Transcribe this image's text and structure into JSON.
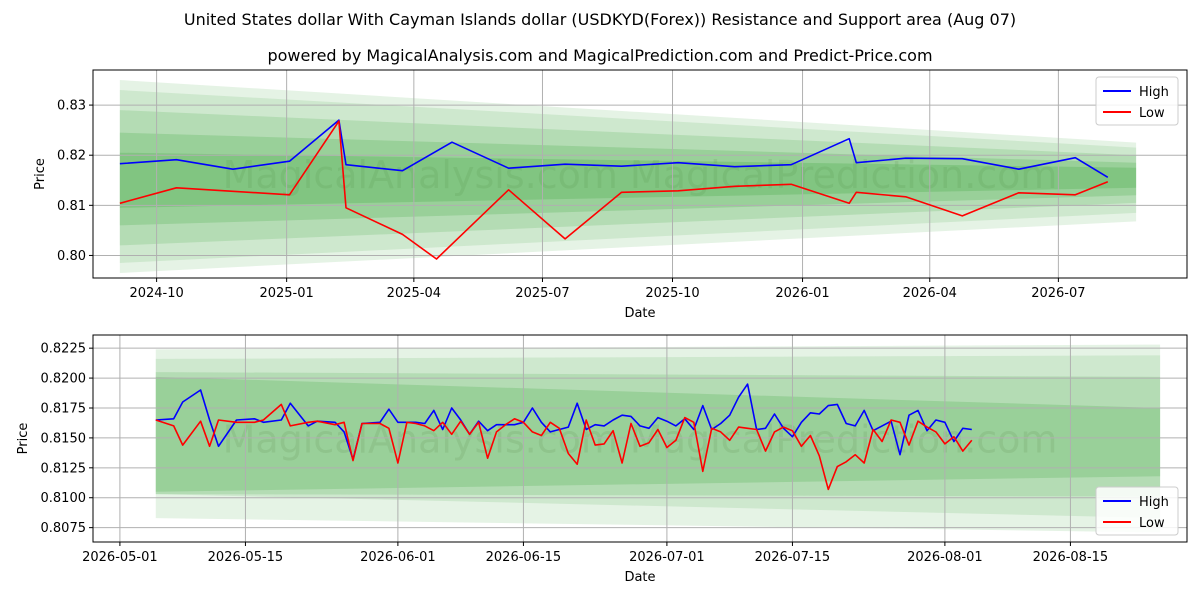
{
  "title": "United States dollar With Cayman Islands dollar (USDKYD(Forex)) Resistance and Support area (Aug 07)",
  "subtitle": "powered by MagicalAnalysis.com and MagicalPrediction.com and Predict-Price.com",
  "watermark": "MagicalAnalysis.com   MagicalPrediction.com",
  "colors": {
    "high": "#0000ff",
    "low": "#ff0000",
    "band": "#2ca02c"
  },
  "chart_data": [
    {
      "type": "line",
      "xlabel": "Date",
      "ylabel": "Price",
      "xticks": [
        "2024-10",
        "2025-01",
        "2025-04",
        "2025-07",
        "2025-10",
        "2026-01",
        "2026-04",
        "2026-07"
      ],
      "yticks": [
        "0.80",
        "0.81",
        "0.82",
        "0.83"
      ],
      "xlim": [
        "2024-08-17",
        "2026-09-30"
      ],
      "ylim": [
        0.7955,
        0.837
      ],
      "grid": true,
      "legend": "top-right",
      "series": [
        {
          "name": "High",
          "x": [
            "2024-09-05",
            "2024-10-15",
            "2024-11-24",
            "2025-01-03",
            "2025-02-07",
            "2025-02-12",
            "2025-03-24",
            "2025-04-28",
            "2025-06-07",
            "2025-07-17",
            "2025-08-26",
            "2025-10-05",
            "2025-11-14",
            "2025-12-24",
            "2026-02-03",
            "2026-02-08",
            "2026-03-15",
            "2026-04-24",
            "2026-06-03",
            "2026-07-13",
            "2026-08-05"
          ],
          "y": [
            0.8183,
            0.8191,
            0.8172,
            0.8188,
            0.827,
            0.8181,
            0.8169,
            0.8226,
            0.8174,
            0.8182,
            0.8178,
            0.8185,
            0.8177,
            0.8181,
            0.8233,
            0.8185,
            0.8194,
            0.8193,
            0.8172,
            0.8195,
            0.8156
          ]
        },
        {
          "name": "Low",
          "x": [
            "2024-09-05",
            "2024-10-15",
            "2024-11-24",
            "2025-01-03",
            "2025-02-07",
            "2025-02-12",
            "2025-03-24",
            "2025-04-17",
            "2025-06-07",
            "2025-07-17",
            "2025-08-26",
            "2025-10-05",
            "2025-11-14",
            "2025-12-24",
            "2026-02-03",
            "2026-02-08",
            "2026-03-15",
            "2026-04-24",
            "2026-06-03",
            "2026-07-13",
            "2026-08-05"
          ],
          "y": [
            0.8104,
            0.8135,
            0.8128,
            0.8121,
            0.8268,
            0.8095,
            0.8042,
            0.7993,
            0.8131,
            0.8033,
            0.8126,
            0.8129,
            0.8138,
            0.8142,
            0.8104,
            0.8126,
            0.8117,
            0.8079,
            0.8125,
            0.8121,
            0.8147
          ]
        }
      ],
      "bands": [
        {
          "x": [
            "2024-09-05",
            "2026-08-25"
          ],
          "upper": [
            0.835,
            0.8225
          ],
          "lower": [
            0.7965,
            0.8068
          ]
        },
        {
          "x": [
            "2024-09-05",
            "2026-08-25"
          ],
          "upper": [
            0.833,
            0.8215
          ],
          "lower": [
            0.7985,
            0.8085
          ]
        },
        {
          "x": [
            "2024-09-05",
            "2026-08-25"
          ],
          "upper": [
            0.829,
            0.82
          ],
          "lower": [
            0.802,
            0.8105
          ]
        },
        {
          "x": [
            "2024-09-05",
            "2026-08-25"
          ],
          "upper": [
            0.8245,
            0.8185
          ],
          "lower": [
            0.806,
            0.812
          ]
        },
        {
          "x": [
            "2024-09-05",
            "2026-08-25"
          ],
          "upper": [
            0.8205,
            0.8175
          ],
          "lower": [
            0.8095,
            0.8135
          ]
        }
      ]
    },
    {
      "type": "line",
      "xlabel": "Date",
      "ylabel": "Price",
      "xticks": [
        "2026-05-01",
        "2026-05-15",
        "2026-06-01",
        "2026-06-15",
        "2026-07-01",
        "2026-07-15",
        "2026-08-01",
        "2026-08-15"
      ],
      "yticks": [
        "0.8075",
        "0.8100",
        "0.8125",
        "0.8150",
        "0.8175",
        "0.8200",
        "0.8225"
      ],
      "xlim": [
        "2026-04-28",
        "2026-08-28"
      ],
      "ylim": [
        0.8063,
        0.8236
      ],
      "grid": true,
      "legend": "bottom-right",
      "series": [
        {
          "name": "High",
          "x": [
            "2026-05-05",
            "2026-05-07",
            "2026-05-08",
            "2026-05-10",
            "2026-05-11",
            "2026-05-12",
            "2026-05-14",
            "2026-05-16",
            "2026-05-17",
            "2026-05-19",
            "2026-05-20",
            "2026-05-22",
            "2026-05-23",
            "2026-05-25",
            "2026-05-26",
            "2026-05-27",
            "2026-05-28",
            "2026-05-30",
            "2026-05-31",
            "2026-06-01",
            "2026-06-02",
            "2026-06-03",
            "2026-06-04",
            "2026-06-05",
            "2026-06-06",
            "2026-06-07",
            "2026-06-08",
            "2026-06-09",
            "2026-06-10",
            "2026-06-11",
            "2026-06-12",
            "2026-06-13",
            "2026-06-14",
            "2026-06-15",
            "2026-06-16",
            "2026-06-17",
            "2026-06-18",
            "2026-06-19",
            "2026-06-20",
            "2026-06-21",
            "2026-06-22",
            "2026-06-23",
            "2026-06-24",
            "2026-06-25",
            "2026-06-26",
            "2026-06-27",
            "2026-06-28",
            "2026-06-29",
            "2026-06-30",
            "2026-07-01",
            "2026-07-02",
            "2026-07-03",
            "2026-07-04",
            "2026-07-05",
            "2026-07-06",
            "2026-07-07",
            "2026-07-08",
            "2026-07-09",
            "2026-07-10",
            "2026-07-11",
            "2026-07-12",
            "2026-07-13",
            "2026-07-14",
            "2026-07-15",
            "2026-07-16",
            "2026-07-17",
            "2026-07-18",
            "2026-07-19",
            "2026-07-20",
            "2026-07-21",
            "2026-07-22",
            "2026-07-23",
            "2026-07-24",
            "2026-07-25",
            "2026-07-26",
            "2026-07-27",
            "2026-07-28",
            "2026-07-29",
            "2026-07-30",
            "2026-07-31",
            "2026-08-01",
            "2026-08-02",
            "2026-08-03",
            "2026-08-04"
          ],
          "y": [
            0.8165,
            0.8166,
            0.818,
            0.819,
            0.8165,
            0.8143,
            0.8165,
            0.8166,
            0.8163,
            0.8165,
            0.8179,
            0.816,
            0.8164,
            0.8163,
            0.8155,
            0.8132,
            0.8162,
            0.8163,
            0.8174,
            0.8163,
            0.8163,
            0.8163,
            0.8162,
            0.8173,
            0.8157,
            0.8175,
            0.8165,
            0.8153,
            0.8164,
            0.8156,
            0.8161,
            0.8161,
            0.8161,
            0.8163,
            0.8175,
            0.8163,
            0.8155,
            0.8157,
            0.8159,
            0.8179,
            0.8157,
            0.8161,
            0.816,
            0.8165,
            0.8169,
            0.8168,
            0.816,
            0.8158,
            0.8167,
            0.8164,
            0.816,
            0.8166,
            0.8157,
            0.8177,
            0.8157,
            0.8162,
            0.8169,
            0.8184,
            0.8195,
            0.8157,
            0.8158,
            0.817,
            0.8158,
            0.8151,
            0.8163,
            0.8171,
            0.817,
            0.8177,
            0.8178,
            0.8162,
            0.816,
            0.8173,
            0.8156,
            0.816,
            0.8164,
            0.8136,
            0.8169,
            0.8173,
            0.8156,
            0.8165,
            0.8163,
            0.8147,
            0.8158,
            0.8157
          ]
        },
        {
          "name": "Low",
          "x": [
            "2026-05-05",
            "2026-05-07",
            "2026-05-08",
            "2026-05-10",
            "2026-05-11",
            "2026-05-12",
            "2026-05-14",
            "2026-05-16",
            "2026-05-17",
            "2026-05-19",
            "2026-05-20",
            "2026-05-22",
            "2026-05-23",
            "2026-05-25",
            "2026-05-26",
            "2026-05-27",
            "2026-05-28",
            "2026-05-30",
            "2026-05-31",
            "2026-06-01",
            "2026-06-02",
            "2026-06-03",
            "2026-06-04",
            "2026-06-05",
            "2026-06-06",
            "2026-06-07",
            "2026-06-08",
            "2026-06-09",
            "2026-06-10",
            "2026-06-11",
            "2026-06-12",
            "2026-06-13",
            "2026-06-14",
            "2026-06-15",
            "2026-06-16",
            "2026-06-17",
            "2026-06-18",
            "2026-06-19",
            "2026-06-20",
            "2026-06-21",
            "2026-06-22",
            "2026-06-23",
            "2026-06-24",
            "2026-06-25",
            "2026-06-26",
            "2026-06-27",
            "2026-06-28",
            "2026-06-29",
            "2026-06-30",
            "2026-07-01",
            "2026-07-02",
            "2026-07-03",
            "2026-07-04",
            "2026-07-05",
            "2026-07-06",
            "2026-07-07",
            "2026-07-08",
            "2026-07-09",
            "2026-07-10",
            "2026-07-11",
            "2026-07-12",
            "2026-07-13",
            "2026-07-14",
            "2026-07-15",
            "2026-07-16",
            "2026-07-17",
            "2026-07-18",
            "2026-07-19",
            "2026-07-20",
            "2026-07-21",
            "2026-07-22",
            "2026-07-23",
            "2026-07-24",
            "2026-07-25",
            "2026-07-26",
            "2026-07-27",
            "2026-07-28",
            "2026-07-29",
            "2026-07-30",
            "2026-07-31",
            "2026-08-01",
            "2026-08-02",
            "2026-08-03",
            "2026-08-04"
          ],
          "y": [
            0.8165,
            0.816,
            0.8144,
            0.8164,
            0.8143,
            0.8165,
            0.8163,
            0.8163,
            0.8165,
            0.8178,
            0.816,
            0.8163,
            0.8164,
            0.8161,
            0.8163,
            0.8131,
            0.8162,
            0.8162,
            0.8158,
            0.8129,
            0.8163,
            0.8162,
            0.816,
            0.8156,
            0.8163,
            0.8153,
            0.8164,
            0.8153,
            0.8163,
            0.8133,
            0.8155,
            0.8161,
            0.8166,
            0.8163,
            0.8155,
            0.8152,
            0.8163,
            0.8158,
            0.8137,
            0.8128,
            0.8165,
            0.8144,
            0.8145,
            0.8156,
            0.8129,
            0.8162,
            0.8143,
            0.8146,
            0.8157,
            0.8142,
            0.8148,
            0.8167,
            0.8163,
            0.8122,
            0.8158,
            0.8155,
            0.8148,
            0.8159,
            0.8158,
            0.8157,
            0.8139,
            0.8155,
            0.8159,
            0.8156,
            0.8143,
            0.8152,
            0.8135,
            0.8107,
            0.8126,
            0.813,
            0.8136,
            0.8129,
            0.8157,
            0.8147,
            0.8165,
            0.8163,
            0.8144,
            0.8164,
            0.8159,
            0.8155,
            0.8145,
            0.8151,
            0.8139,
            0.8148
          ]
        }
      ],
      "bands": [
        {
          "x": [
            "2026-05-05",
            "2026-08-25"
          ],
          "upper": [
            0.8224,
            0.8228
          ],
          "lower": [
            0.8083,
            0.8071
          ]
        },
        {
          "x": [
            "2026-05-05",
            "2026-08-25"
          ],
          "upper": [
            0.8216,
            0.8219
          ],
          "lower": [
            0.8103,
            0.8083
          ]
        },
        {
          "x": [
            "2026-05-05",
            "2026-08-25"
          ],
          "upper": [
            0.8205,
            0.8201
          ],
          "lower": [
            0.8103,
            0.8101
          ]
        },
        {
          "x": [
            "2026-05-05",
            "2026-08-25"
          ],
          "upper": [
            0.8201,
            0.8175
          ],
          "lower": [
            0.8105,
            0.8118
          ]
        }
      ]
    }
  ]
}
